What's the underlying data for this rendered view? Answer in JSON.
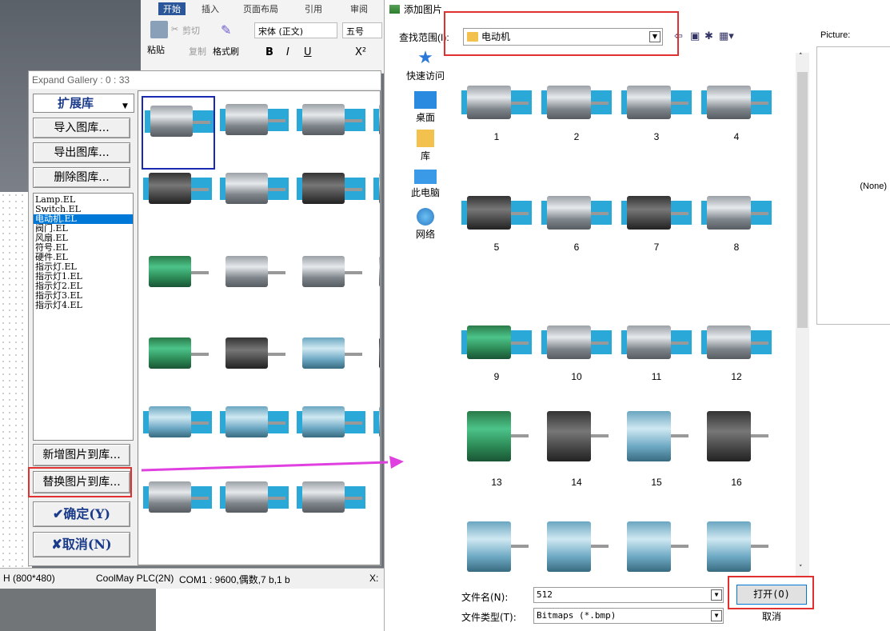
{
  "word_ribbon": {
    "tabs": [
      "开始",
      "插入",
      "页面布局",
      "引用",
      "审阅"
    ],
    "paste": "粘贴",
    "cut": "剪切",
    "copy": "复制",
    "format_painter": "格式刷",
    "font": "宋体 (正文)",
    "font_size": "五号"
  },
  "gallery": {
    "title": "Expand Gallery : 0 : 33",
    "library_select": "扩展库",
    "import_button": "导入图库...",
    "export_button": "导出图库...",
    "delete_button": "删除图库...",
    "libraries": [
      "Lamp.EL",
      "Switch.EL",
      "电动机.EL",
      "阀门.EL",
      "风扇.EL",
      "符号.EL",
      "硬件.EL",
      "指示灯.EL",
      "指示灯1.EL",
      "指示灯2.EL",
      "指示灯3.EL",
      "指示灯4.EL"
    ],
    "selected_library": "电动机.EL",
    "add_picture_button": "新增图片到库...",
    "replace_picture_button": "替换图片到库...",
    "ok_button": "✔确定(Y)",
    "cancel_button": "✘取消(N)"
  },
  "statusbar": {
    "resolution": "H (800*480)",
    "plc": "CoolMay PLC(2N)",
    "com": "COM1 : 9600,偶数,7 b,1 b",
    "x": "X:"
  },
  "dialog": {
    "title": "添加图片",
    "look_in_label": "查找范围(I):",
    "look_in_value": "电动机",
    "places": [
      "快速访问",
      "桌面",
      "库",
      "此电脑",
      "网络"
    ],
    "files": [
      "1",
      "2",
      "3",
      "4",
      "5",
      "6",
      "7",
      "8",
      "9",
      "10",
      "11",
      "12",
      "13",
      "14",
      "15",
      "16"
    ],
    "filename_label": "文件名(N):",
    "filename_value": "512",
    "filetype_label": "文件类型(T):",
    "filetype_value": "Bitmaps (*.bmp)",
    "open_button": "打开(O)",
    "cancel_button": "取消",
    "picture_label": "Picture:",
    "picture_preview": "(None)"
  },
  "colors": {
    "accent_red": "#e03030",
    "arrow_magenta": "#e040e0",
    "selection_blue": "#0078d7"
  }
}
